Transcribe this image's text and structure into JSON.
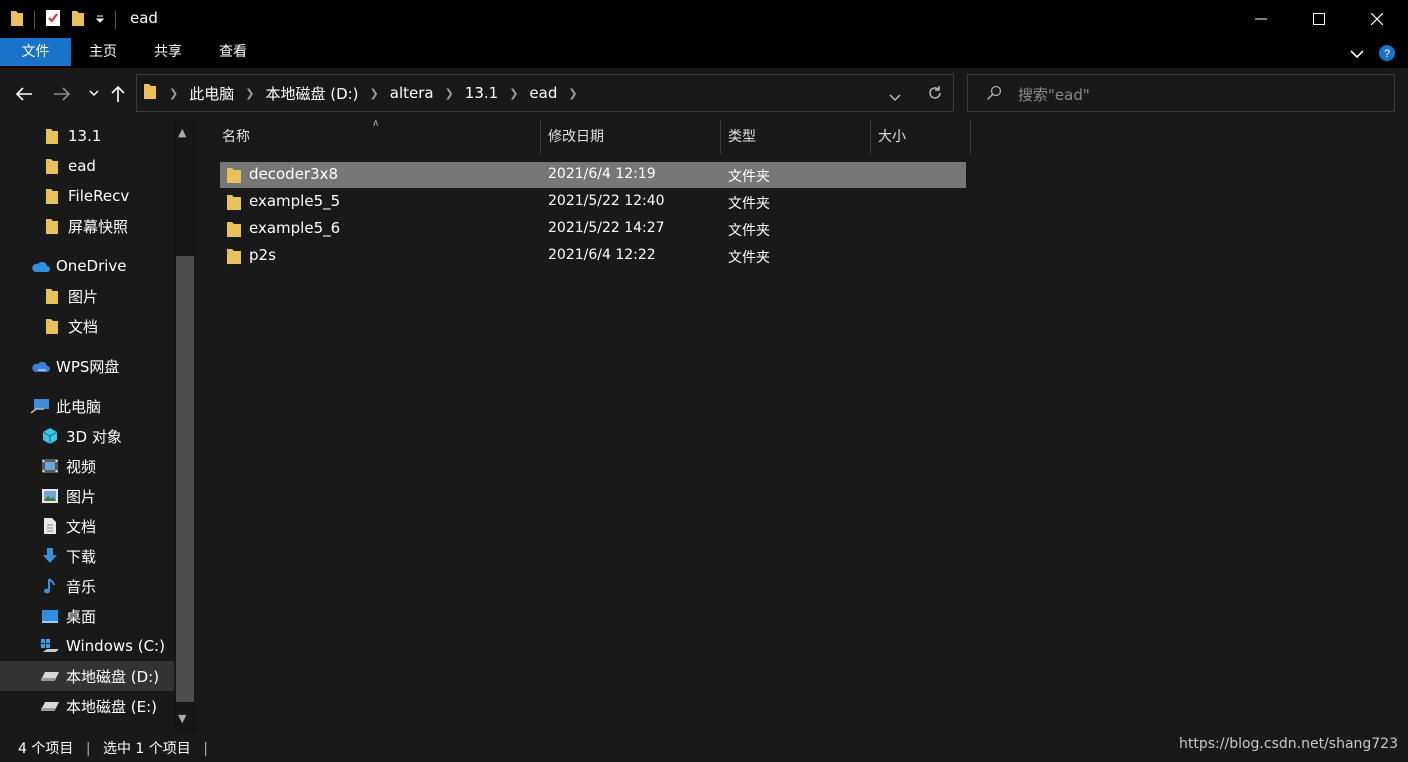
{
  "window": {
    "title": "ead"
  },
  "ribbon": {
    "tabs": [
      {
        "label": "文件",
        "active": true
      },
      {
        "label": "主页",
        "active": false
      },
      {
        "label": "共享",
        "active": false
      },
      {
        "label": "查看",
        "active": false
      }
    ]
  },
  "address": {
    "crumbs": [
      "此电脑",
      "本地磁盘 (D:)",
      "altera",
      "13.1",
      "ead"
    ]
  },
  "search": {
    "placeholder": "搜索\"ead\""
  },
  "sidebar": {
    "items": [
      {
        "label": "13.1",
        "icon": "folder-icon"
      },
      {
        "label": "ead",
        "icon": "folder-icon"
      },
      {
        "label": "FileRecv",
        "icon": "folder-icon"
      },
      {
        "label": "屏幕快照",
        "icon": "folder-icon"
      },
      {
        "label": "OneDrive",
        "icon": "onedrive-icon"
      },
      {
        "label": "图片",
        "icon": "folder-icon"
      },
      {
        "label": "文档",
        "icon": "folder-icon"
      },
      {
        "label": "WPS网盘",
        "icon": "cloud-icon"
      },
      {
        "label": "此电脑",
        "icon": "computer-icon"
      },
      {
        "label": "3D 对象",
        "icon": "cube-icon"
      },
      {
        "label": "视频",
        "icon": "video-icon"
      },
      {
        "label": "图片",
        "icon": "picture-icon"
      },
      {
        "label": "文档",
        "icon": "document-icon"
      },
      {
        "label": "下载",
        "icon": "download-icon"
      },
      {
        "label": "音乐",
        "icon": "music-icon"
      },
      {
        "label": "桌面",
        "icon": "desktop-icon"
      },
      {
        "label": "Windows (C:)",
        "icon": "windows-drive-icon"
      },
      {
        "label": "本地磁盘 (D:)",
        "icon": "drive-icon",
        "selected": true
      },
      {
        "label": "本地磁盘 (E:)",
        "icon": "drive-icon"
      }
    ]
  },
  "columns": {
    "name": "名称",
    "date": "修改日期",
    "type": "类型",
    "size": "大小"
  },
  "files": [
    {
      "name": "decoder3x8",
      "date": "2021/6/4 12:19",
      "type": "文件夹",
      "selected": true
    },
    {
      "name": "example5_5",
      "date": "2021/5/22 12:40",
      "type": "文件夹"
    },
    {
      "name": "example5_6",
      "date": "2021/5/22 14:27",
      "type": "文件夹"
    },
    {
      "name": "p2s",
      "date": "2021/6/4 12:22",
      "type": "文件夹"
    }
  ],
  "status": {
    "count": "4 个项目",
    "selected": "选中 1 个项目"
  },
  "watermark": "https://blog.csdn.net/shang723",
  "colors": {
    "accent": "#1a73c9",
    "folder": "#e8c15a",
    "selected_row": "#777777"
  }
}
